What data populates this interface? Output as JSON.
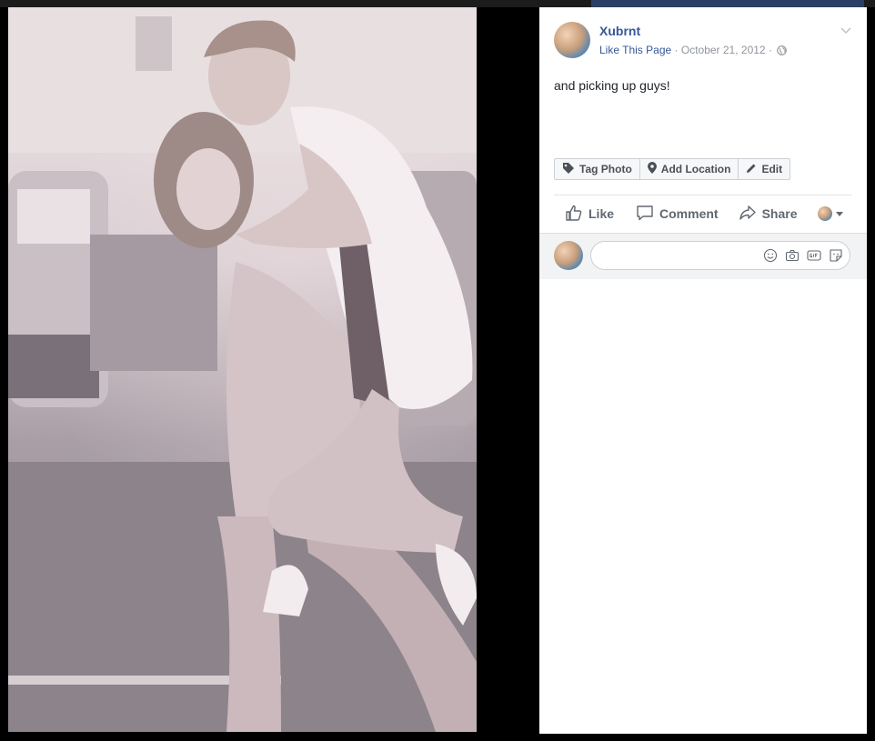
{
  "page": {
    "name": "Xubrnt",
    "like_page_label": "Like This Page",
    "date": "October 21, 2012",
    "separator": "·"
  },
  "post": {
    "text": "and picking up guys!"
  },
  "photo_actions": {
    "tag_photo": "Tag Photo",
    "add_location": "Add Location",
    "edit": "Edit"
  },
  "ufi": {
    "like": "Like",
    "comment": "Comment",
    "share": "Share"
  },
  "comment_box": {
    "placeholder": ""
  },
  "icons": {
    "audience": "globe-icon",
    "menu": "chevron-down-icon",
    "tag": "tag-icon",
    "location": "location-pin-icon",
    "edit": "pencil-icon",
    "like": "thumbs-up-icon",
    "comment": "speech-bubble-icon",
    "share": "share-arrow-icon",
    "emoji": "smiley-icon",
    "camera": "camera-icon",
    "gif": "gif-icon",
    "sticker": "sticker-icon"
  },
  "colors": {
    "link": "#365899",
    "panel_bg": "#ffffff",
    "overlay_bg": "#000000"
  }
}
